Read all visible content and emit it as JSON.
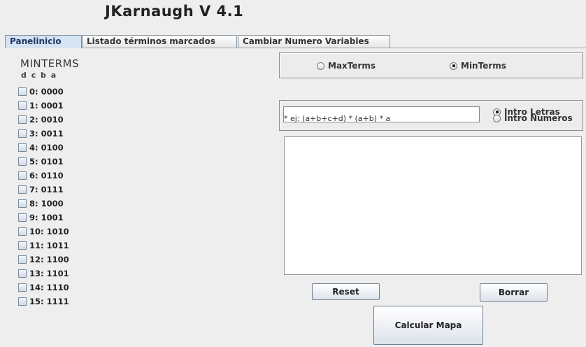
{
  "app": {
    "title": "JKarnaugh  V 4.1"
  },
  "tabs": [
    {
      "label": "Panelinicio",
      "active": true
    },
    {
      "label": "Listado términos marcados",
      "active": false
    },
    {
      "label": "Cambiar Numero Variables",
      "active": false
    }
  ],
  "minterms": {
    "title": "MINTERMS",
    "bits_header": "d c b a",
    "items": [
      "0: 0000",
      "1: 0001",
      "2: 0010",
      "3: 0011",
      "4: 0100",
      "5: 0101",
      "6: 0110",
      "7: 0111",
      "8: 1000",
      "9: 1001",
      "10: 1010",
      "11: 1011",
      "12: 1100",
      "13: 1101",
      "14: 1110",
      "15: 1111"
    ]
  },
  "term_mode": {
    "maxterms_label": "MaxTerms",
    "minterms_label": "MinTerms",
    "selected": "MinTerms"
  },
  "input_mode": {
    "letters_label": "Intro Letras",
    "numbers_label": "Intro Numeros",
    "selected": "Intro Letras",
    "expression_value": "",
    "hint": "* ej: (a+b+c+d) * (a+b) * a"
  },
  "buttons": {
    "reset": "Reset",
    "borrar": "Borrar",
    "calcular": "Calcular Mapa"
  }
}
